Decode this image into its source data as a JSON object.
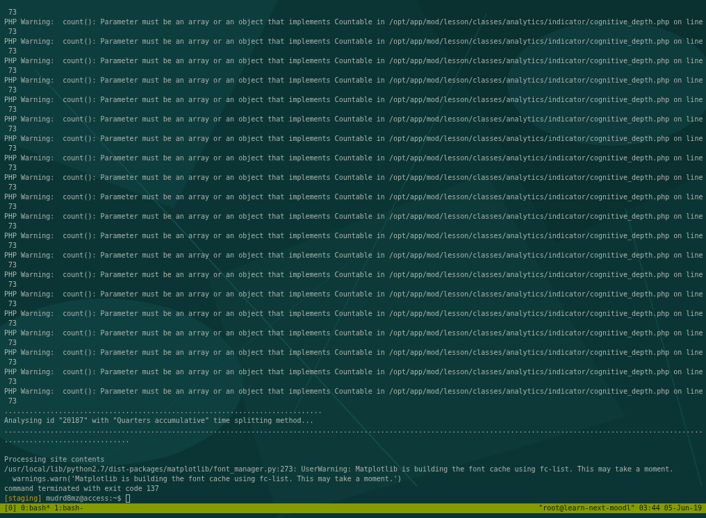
{
  "terminal": {
    "lines": [
      {
        "kind": "output",
        "text": " 73"
      },
      {
        "kind": "output",
        "text": "PHP Warning:  count(): Parameter must be an array or an object that implements Countable in /opt/app/mod/lesson/classes/analytics/indicator/cognitive_depth.php on line"
      },
      {
        "kind": "output",
        "text": " 73"
      },
      {
        "kind": "output",
        "text": "PHP Warning:  count(): Parameter must be an array or an object that implements Countable in /opt/app/mod/lesson/classes/analytics/indicator/cognitive_depth.php on line"
      },
      {
        "kind": "output",
        "text": " 73"
      },
      {
        "kind": "output",
        "text": "PHP Warning:  count(): Parameter must be an array or an object that implements Countable in /opt/app/mod/lesson/classes/analytics/indicator/cognitive_depth.php on line"
      },
      {
        "kind": "output",
        "text": " 73"
      },
      {
        "kind": "output",
        "text": "PHP Warning:  count(): Parameter must be an array or an object that implements Countable in /opt/app/mod/lesson/classes/analytics/indicator/cognitive_depth.php on line"
      },
      {
        "kind": "output",
        "text": " 73"
      },
      {
        "kind": "output",
        "text": "PHP Warning:  count(): Parameter must be an array or an object that implements Countable in /opt/app/mod/lesson/classes/analytics/indicator/cognitive_depth.php on line"
      },
      {
        "kind": "output",
        "text": " 73"
      },
      {
        "kind": "output",
        "text": "PHP Warning:  count(): Parameter must be an array or an object that implements Countable in /opt/app/mod/lesson/classes/analytics/indicator/cognitive_depth.php on line"
      },
      {
        "kind": "output",
        "text": " 73"
      },
      {
        "kind": "output",
        "text": "PHP Warning:  count(): Parameter must be an array or an object that implements Countable in /opt/app/mod/lesson/classes/analytics/indicator/cognitive_depth.php on line"
      },
      {
        "kind": "output",
        "text": " 73"
      },
      {
        "kind": "output",
        "text": "PHP Warning:  count(): Parameter must be an array or an object that implements Countable in /opt/app/mod/lesson/classes/analytics/indicator/cognitive_depth.php on line"
      },
      {
        "kind": "output",
        "text": " 73"
      },
      {
        "kind": "output",
        "text": "PHP Warning:  count(): Parameter must be an array or an object that implements Countable in /opt/app/mod/lesson/classes/analytics/indicator/cognitive_depth.php on line"
      },
      {
        "kind": "output",
        "text": " 73"
      },
      {
        "kind": "output",
        "text": "PHP Warning:  count(): Parameter must be an array or an object that implements Countable in /opt/app/mod/lesson/classes/analytics/indicator/cognitive_depth.php on line"
      },
      {
        "kind": "output",
        "text": " 73"
      },
      {
        "kind": "output",
        "text": "PHP Warning:  count(): Parameter must be an array or an object that implements Countable in /opt/app/mod/lesson/classes/analytics/indicator/cognitive_depth.php on line"
      },
      {
        "kind": "output",
        "text": " 73"
      },
      {
        "kind": "output",
        "text": "PHP Warning:  count(): Parameter must be an array or an object that implements Countable in /opt/app/mod/lesson/classes/analytics/indicator/cognitive_depth.php on line"
      },
      {
        "kind": "output",
        "text": " 73"
      },
      {
        "kind": "output",
        "text": "PHP Warning:  count(): Parameter must be an array or an object that implements Countable in /opt/app/mod/lesson/classes/analytics/indicator/cognitive_depth.php on line"
      },
      {
        "kind": "output",
        "text": " 73"
      },
      {
        "kind": "output",
        "text": "PHP Warning:  count(): Parameter must be an array or an object that implements Countable in /opt/app/mod/lesson/classes/analytics/indicator/cognitive_depth.php on line"
      },
      {
        "kind": "output",
        "text": " 73"
      },
      {
        "kind": "output",
        "text": "PHP Warning:  count(): Parameter must be an array or an object that implements Countable in /opt/app/mod/lesson/classes/analytics/indicator/cognitive_depth.php on line"
      },
      {
        "kind": "output",
        "text": " 73"
      },
      {
        "kind": "output",
        "text": "PHP Warning:  count(): Parameter must be an array or an object that implements Countable in /opt/app/mod/lesson/classes/analytics/indicator/cognitive_depth.php on line"
      },
      {
        "kind": "output",
        "text": " 73"
      },
      {
        "kind": "output",
        "text": "PHP Warning:  count(): Parameter must be an array or an object that implements Countable in /opt/app/mod/lesson/classes/analytics/indicator/cognitive_depth.php on line"
      },
      {
        "kind": "output",
        "text": " 73"
      },
      {
        "kind": "output",
        "text": "PHP Warning:  count(): Parameter must be an array or an object that implements Countable in /opt/app/mod/lesson/classes/analytics/indicator/cognitive_depth.php on line"
      },
      {
        "kind": "output",
        "text": " 73"
      },
      {
        "kind": "output",
        "text": "PHP Warning:  count(): Parameter must be an array or an object that implements Countable in /opt/app/mod/lesson/classes/analytics/indicator/cognitive_depth.php on line"
      },
      {
        "kind": "output",
        "text": " 73"
      },
      {
        "kind": "output",
        "text": "PHP Warning:  count(): Parameter must be an array or an object that implements Countable in /opt/app/mod/lesson/classes/analytics/indicator/cognitive_depth.php on line"
      },
      {
        "kind": "output",
        "text": " 73"
      },
      {
        "kind": "output",
        "text": "............................................................................"
      },
      {
        "kind": "output",
        "text": "Analysing id \"20187\" with \"Quarters accumulative\" time splitting method..."
      },
      {
        "kind": "output",
        "text": "......................................................................................................................................................................."
      },
      {
        "kind": "output",
        "text": ".............................."
      },
      {
        "kind": "blank"
      },
      {
        "kind": "output",
        "text": "Processing site contents"
      },
      {
        "kind": "output",
        "text": "/usr/local/lib/python2.7/dist-packages/matplotlib/font_manager.py:273: UserWarning: Matplotlib is building the font cache using fc-list. This may take a moment."
      },
      {
        "kind": "output",
        "text": "  warnings.warn('Matplotlib is building the font cache using fc-list. This may take a moment.')"
      },
      {
        "kind": "output",
        "text": "command terminated with exit code 137"
      },
      {
        "kind": "prompt",
        "tag": "[staging]",
        "text": "mudrd8mz@access:~$"
      }
    ]
  },
  "status_bar": {
    "session": "[0]",
    "windows": [
      {
        "label": "0:bash*"
      },
      {
        "label": "1:bash-"
      }
    ],
    "pane_title": "\"root@learn-next-moodl\"",
    "time": "03:44",
    "date": "05-Jun-19"
  }
}
